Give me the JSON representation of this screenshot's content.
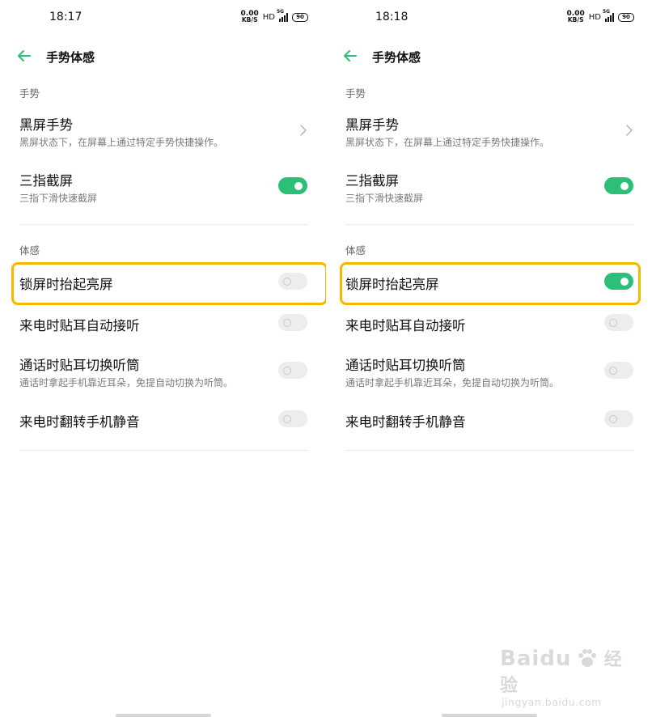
{
  "screens": [
    {
      "status_bar": {
        "time": "18:17",
        "net_speed_value": "0.00",
        "net_speed_unit": "KB/S",
        "hd": "HD",
        "network": "5G",
        "battery": "90"
      },
      "nav": {
        "title": "手势体感",
        "back_icon": "back-arrow-icon"
      },
      "section_gesture": "手势",
      "black_screen": {
        "title": "黑屏手势",
        "subtitle": "黑屏状态下，在屏幕上通过特定手势快捷操作。"
      },
      "three_finger": {
        "title": "三指截屏",
        "subtitle": "三指下滑快速截屏",
        "enabled": true
      },
      "section_motion": "体感",
      "raise_to_wake": {
        "title": "锁屏时抬起亮屏",
        "enabled": false
      },
      "auto_answer": {
        "title": "来电时贴耳自动接听",
        "enabled": false
      },
      "earpiece_switch": {
        "title": "通话时贴耳切换听筒",
        "subtitle": "通话时拿起手机靠近耳朵，免提自动切换为听筒。",
        "enabled": false
      },
      "flip_mute": {
        "title": "来电时翻转手机静音",
        "enabled": false
      }
    },
    {
      "status_bar": {
        "time": "18:18",
        "net_speed_value": "0.00",
        "net_speed_unit": "KB/S",
        "hd": "HD",
        "network": "5G",
        "battery": "90"
      },
      "nav": {
        "title": "手势体感",
        "back_icon": "back-arrow-icon"
      },
      "section_gesture": "手势",
      "black_screen": {
        "title": "黑屏手势",
        "subtitle": "黑屏状态下，在屏幕上通过特定手势快捷操作。"
      },
      "three_finger": {
        "title": "三指截屏",
        "subtitle": "三指下滑快速截屏",
        "enabled": true
      },
      "section_motion": "体感",
      "raise_to_wake": {
        "title": "锁屏时抬起亮屏",
        "enabled": true
      },
      "auto_answer": {
        "title": "来电时贴耳自动接听",
        "enabled": false
      },
      "earpiece_switch": {
        "title": "通话时贴耳切换听筒",
        "subtitle": "通话时拿起手机靠近耳朵，免提自动切换为听筒。",
        "enabled": false
      },
      "flip_mute": {
        "title": "来电时翻转手机静音",
        "enabled": false
      }
    }
  ],
  "colors": {
    "accent": "#2bbf77",
    "highlight": "#f5b800",
    "toggle_off": "#ededed"
  },
  "watermark": {
    "logo": "Baidu",
    "product": "经验",
    "url": "jingyan.baidu.com"
  }
}
